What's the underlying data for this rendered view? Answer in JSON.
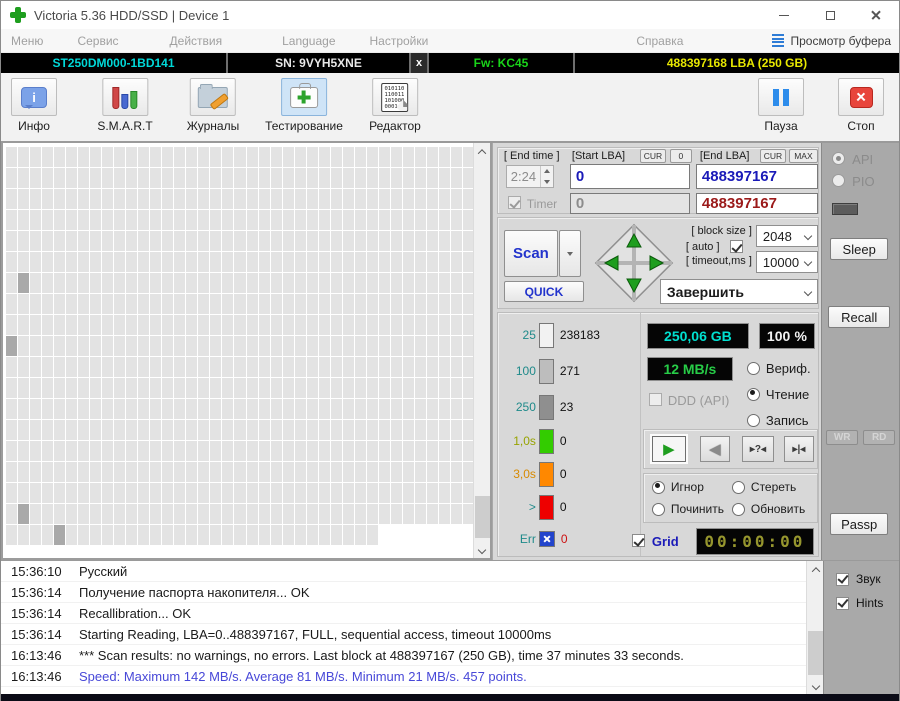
{
  "window": {
    "title": "Victoria 5.36 HDD/SSD | Device 1"
  },
  "menu": {
    "items": [
      "Меню",
      "Сервис",
      "Действия",
      "Language",
      "Настройки",
      "Справка"
    ],
    "buffer_button": "Просмотр буфера"
  },
  "device_bar": {
    "model": "ST250DM000-1BD141",
    "serial": "SN: 9VYH5XNE",
    "detach": "x",
    "firmware": "Fw: KC45",
    "capacity": "488397168 LBA (250 GB)"
  },
  "toolbar": {
    "info": "Инфо",
    "info_glyph": "i",
    "smart": "S.M.A.R.T",
    "logs": "Журналы",
    "test": "Тестирование",
    "editor": "Редактор",
    "editor_lines": [
      "010110",
      "110011",
      "101000",
      "0001"
    ],
    "pause": "Пауза",
    "stop": "Стоп"
  },
  "scan_setup": {
    "end_time_label": "[ End time ]",
    "end_time": "2:24",
    "timer_label": "Timer",
    "start_lba_label": "[Start LBA]",
    "start_cur": "CUR",
    "start_zero": "0",
    "start_value": "0",
    "start_value_row2": "0",
    "end_lba_label": "[End LBA]",
    "end_cur": "CUR",
    "end_max": "MAX",
    "end_value": "488397167",
    "end_value_row2": "488397167",
    "scan": "Scan",
    "quick": "QUICK",
    "block_size_label": "[ block size ]",
    "auto_label": "[ auto ]",
    "block_size": "2048",
    "timeout_label": "[ timeout,ms ]",
    "timeout": "10000",
    "after_action": "Завершить"
  },
  "stats": {
    "rows": [
      {
        "label": "25",
        "label_color": "#1f8a8a",
        "block_color": "#f2f2f2",
        "value": "238183",
        "value_color": "#111111"
      },
      {
        "label": "100",
        "label_color": "#1f8a8a",
        "block_color": "#bdbdbd",
        "value": "271",
        "value_color": "#111111"
      },
      {
        "label": "250",
        "label_color": "#1f8a8a",
        "block_color": "#8f8f8f",
        "value": "23",
        "value_color": "#111111"
      },
      {
        "label": "1,0s",
        "label_color": "#97a300",
        "block_color": "#33cc00",
        "value": "0",
        "value_color": "#111111"
      },
      {
        "label": "3,0s",
        "label_color": "#d78a00",
        "block_color": "#ff8800",
        "value": "0",
        "value_color": "#111111"
      },
      {
        "label": ">",
        "label_color": "#1f8a8a",
        "block_color": "#ee0000",
        "value": "0",
        "value_color": "#111111"
      },
      {
        "label": "Err",
        "label_color": "#1f8a8a",
        "block_color": "#2244cc",
        "value": "0",
        "value_color": "#cc1111",
        "err": true
      }
    ]
  },
  "monitor": {
    "capacity": "250,06 GB",
    "percent": "100",
    "percent_unit": "%",
    "speed": "12 MB/s",
    "ddd": "DDD (API)",
    "grid_label": "Grid",
    "clock": "00:00:00"
  },
  "mode_radios": [
    {
      "label": "Вериф.",
      "selected": false
    },
    {
      "label": "Чтение",
      "selected": true
    },
    {
      "label": "Запись",
      "selected": false
    }
  ],
  "action_radios": [
    {
      "label": "Игнор",
      "selected": true
    },
    {
      "label": "Стереть",
      "selected": false
    },
    {
      "label": "Починить",
      "selected": false
    },
    {
      "label": "Обновить",
      "selected": false
    }
  ],
  "transport": [
    {
      "name": "play-button",
      "glyph": "▶",
      "class": "t-play",
      "selected": true
    },
    {
      "name": "rewind-button",
      "glyph": "◀",
      "class": "t-rew",
      "selected": false
    },
    {
      "name": "seek-scan-button",
      "glyph": "▸?◂",
      "class": "t-seek",
      "selected": false
    },
    {
      "name": "seek-end-button",
      "glyph": "▸|◂",
      "class": "t-seek",
      "selected": false
    }
  ],
  "side_panel": {
    "api": "API",
    "pio": "PIO",
    "sleep": "Sleep",
    "recall": "Recall",
    "wr": "WR",
    "rd": "RD",
    "passp": "Passp"
  },
  "log": {
    "entries": [
      {
        "time": "15:36:10",
        "text": "Русский",
        "color": "#1a1a1a"
      },
      {
        "time": "15:36:14",
        "text": "Получение паспорта накопителя... OK",
        "color": "#1a1a1a"
      },
      {
        "time": "15:36:14",
        "text": "Recallibration... OK",
        "color": "#1a1a1a"
      },
      {
        "time": "15:36:14",
        "text": "Starting Reading, LBA=0..488397167, FULL, sequential access, timeout 10000ms",
        "color": "#1a1a1a"
      },
      {
        "time": "16:13:46",
        "text": "*** Scan results: no warnings, no errors. Last block at 488397167 (250 GB), time 37 minutes 33 seconds.",
        "color": "#1a1a1a"
      },
      {
        "time": "16:13:46",
        "text": "Speed: Maximum 142 MB/s. Average 81 MB/s. Minimum 21 MB/s. 457 points.",
        "color": "#4848d8"
      }
    ],
    "sound": "Звук",
    "hints": "Hints"
  },
  "grid": {
    "cols": 39,
    "rows": 19,
    "last_row_cols": 31,
    "slow_blocks": [
      [
        7,
        2
      ],
      [
        10,
        1
      ],
      [
        18,
        2
      ],
      [
        19,
        5
      ]
    ],
    "block_color": "#e3e3e3",
    "slow_color": "#a9a9a9"
  },
  "colors": {
    "model": "#00d8d8",
    "firmware": "#19d419",
    "capacity": "#e8e800",
    "lcd_capacity": "#00e0d0",
    "lcd_speed": "#27cc47",
    "lcd_clock": "#96962e",
    "accent_blue": "#2233cc",
    "lba_value": "#1a1ab8",
    "lba_value2": "#9b1a1a"
  }
}
